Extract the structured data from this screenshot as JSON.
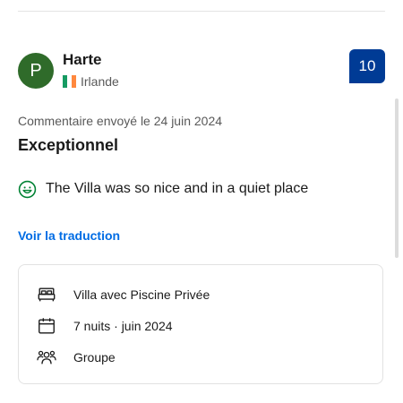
{
  "review": {
    "avatar_initial": "P",
    "reviewer_name": "Harte",
    "country": "Irlande",
    "score": "10",
    "date_text": "Commentaire envoyé le 24 juin 2024",
    "title": "Exceptionnel",
    "positive_text": "The Villa was so nice and in a quiet place",
    "translate_label": "Voir la traduction"
  },
  "stay": {
    "room": "Villa avec Piscine Privée",
    "duration": "7 nuits · juin 2024",
    "traveler_type": "Groupe"
  },
  "icons": {
    "flag": "ireland-flag-icon",
    "positive": "smiley-face-icon",
    "room": "bed-icon",
    "duration": "calendar-icon",
    "traveler": "group-people-icon"
  },
  "colors": {
    "avatar_bg": "#2f6b2a",
    "score_bg": "#003b95",
    "link": "#006ce4",
    "positive_icon": "#008234"
  }
}
